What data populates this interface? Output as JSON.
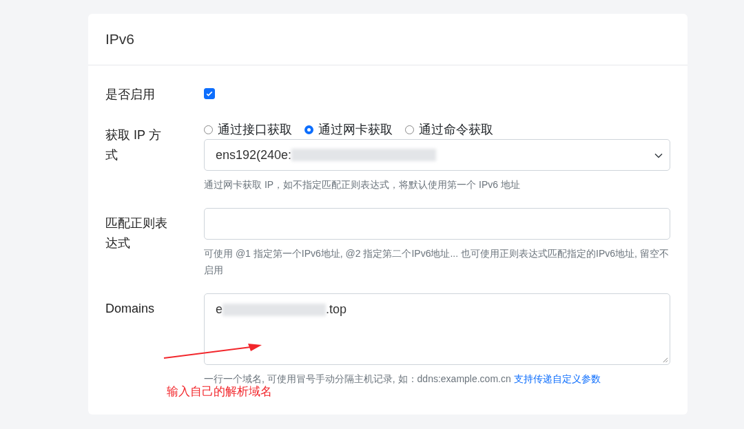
{
  "card": {
    "title": "IPv6"
  },
  "fields": [
    {
      "kind": "checkbox",
      "label": "是否启用",
      "checked": true
    },
    {
      "kind": "radio-select",
      "label": "获取 IP 方式",
      "options": [
        {
          "label": "通过接口获取",
          "selected": false
        },
        {
          "label": "通过网卡获取",
          "selected": true
        },
        {
          "label": "通过命令获取",
          "selected": false
        }
      ],
      "value_start": "ens192(240e:",
      "help": "通过网卡获取 IP，如不指定匹配正则表达式，将默认使用第一个 IPv6 地址"
    },
    {
      "kind": "input",
      "label": "匹配正则表达式",
      "help": "可使用 @1 指定第一个IPv6地址, @2 指定第二个IPv6地址... 也可使用正则表达式匹配指定的IPv6地址, 留空不启用"
    },
    {
      "kind": "textarea",
      "label": "Domains",
      "value_start": "e",
      "value_end": ".top",
      "help": "一行一个域名, 可使用冒号手动分隔主机记录, 如：ddns:example.com.cn",
      "link": "支持传递自定义参数"
    }
  ],
  "annotation": {
    "text": "输入自己的解析域名"
  }
}
